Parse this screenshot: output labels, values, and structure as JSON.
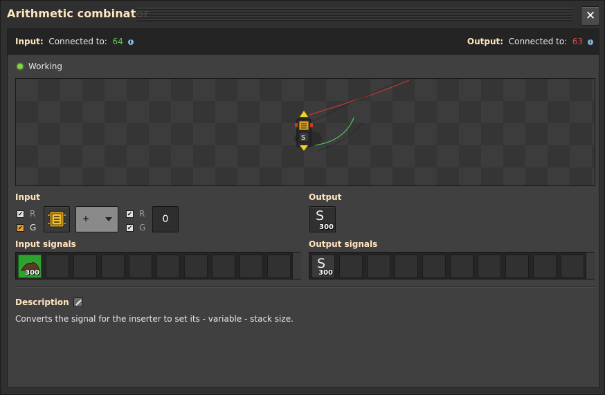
{
  "window": {
    "title": "Arithmetic combinator",
    "close_label": "✕"
  },
  "connections": {
    "input_label": "Input:",
    "input_text": "Connected to:",
    "input_count": "64",
    "output_label": "Output:",
    "output_text": "Connected to:",
    "output_count": "63"
  },
  "status": {
    "text": "Working",
    "color": "#7ed83a"
  },
  "input": {
    "heading": "Input",
    "left_wires": [
      {
        "label": "R",
        "checked": true
      },
      {
        "label": "G",
        "checked": true
      }
    ],
    "operator": "+",
    "right_wires": [
      {
        "label": "R",
        "checked": true
      },
      {
        "label": "G",
        "checked": true
      }
    ],
    "constant": "0"
  },
  "output": {
    "heading": "Output",
    "signal_letter": "S",
    "signal_amount": "300"
  },
  "input_signals": {
    "heading": "Input signals",
    "first_amount": "300"
  },
  "output_signals": {
    "heading": "Output signals",
    "first_letter": "S",
    "first_amount": "300"
  },
  "description": {
    "heading": "Description",
    "text": "Converts the signal for the inserter to set its - variable - stack size."
  }
}
